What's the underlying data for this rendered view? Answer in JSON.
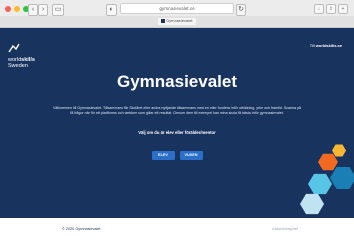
{
  "browser": {
    "address": "gymnasievalet.se",
    "tab_title": "Gymnasievalet",
    "colors": {
      "close": "#ff5f57",
      "minimize": "#febc2e",
      "zoom": "#28c840"
    }
  },
  "site": {
    "logo_line1": "world",
    "logo_line2": "skills",
    "logo_line3": "Sweden",
    "top_link_prefix": "Till ",
    "top_link_bold": "worldskills.se",
    "title": "Gymnasievalet",
    "intro": "Välkommen till Gymnasievalet. Tillsammans får Skolåret eller andra nyttjande tillsammans med en eller fundera inför utbildning, yrke och framtid. Scanna på få frågor när för ett plattforms och webben som gillar ett resultat. Genom dem till exempel kan mina skola få bästa inför gymnasievalet.",
    "prompt": "Välj om du är elev eller förälder/mentor",
    "buttons": [
      "ELEV",
      "VUXEN"
    ],
    "footer_copy": "© 2020 Gymnasievalet",
    "footer_right": "Kakor/Integritet"
  },
  "colors": {
    "page_bg": "#19335f",
    "button": "#2a6fc9",
    "hex_orange": "#f26a21",
    "hex_yellow": "#f7b733",
    "hex_teal": "#1a7fb5",
    "hex_light": "#58c4e6",
    "hex_pale": "#bfe3f0"
  }
}
